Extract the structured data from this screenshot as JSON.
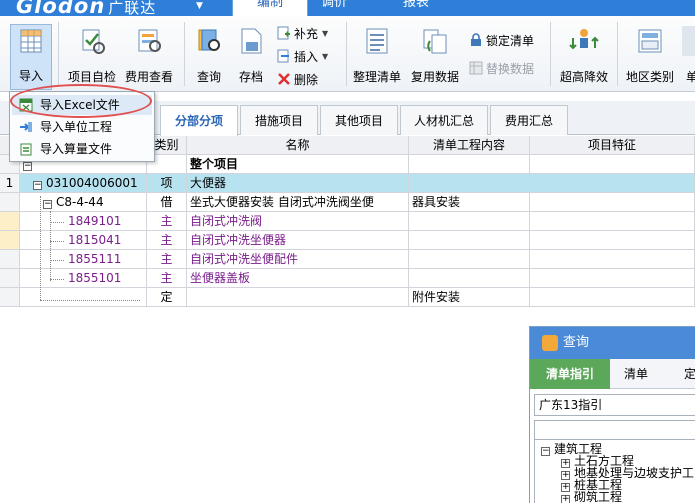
{
  "app": {
    "logo_text": "Glodon",
    "logo_cn": "广联达",
    "main_tabs": [
      "编制",
      "调价",
      "报表"
    ]
  },
  "ribbon": {
    "import": "导入",
    "self_check": "项目自检",
    "fee_view": "费用查看",
    "query": "查询",
    "save": "存档",
    "supplement": "补充",
    "insert": "插入",
    "delete": "删除",
    "organize": "整理清单",
    "reuse": "复用数据",
    "lock": "锁定清单",
    "replace": "替换数据",
    "reduce": "超高降效",
    "region": "地区类别",
    "cut_label": "单"
  },
  "import_menu": {
    "items": [
      "导入Excel文件",
      "导入单位工程",
      "导入算量文件"
    ]
  },
  "subtabs": [
    "分部分项",
    "措施项目",
    "其他项目",
    "人材机汇总",
    "费用汇总"
  ],
  "grid": {
    "headers": {
      "type": "类别",
      "name": "名称",
      "content": "清单工程内容",
      "feature": "项目特征"
    },
    "rows": [
      {
        "num": "",
        "code": "",
        "type": "",
        "name": "整个项目",
        "content": ""
      },
      {
        "num": "1",
        "code": "031004006001",
        "type": "项",
        "name": "大便器",
        "content": ""
      },
      {
        "num": "",
        "code": "C8-4-44",
        "type": "借",
        "name": "坐式大便器安装 自闭式冲洗阀坐便",
        "content": "器具安装"
      },
      {
        "num": "",
        "code": "1849101",
        "type": "主",
        "name": "自闭式冲洗阀",
        "content": ""
      },
      {
        "num": "",
        "code": "1815041",
        "type": "主",
        "name": "自闭式冲洗坐便器",
        "content": ""
      },
      {
        "num": "",
        "code": "1855111",
        "type": "主",
        "name": "自闭式冲洗坐便配件",
        "content": ""
      },
      {
        "num": "",
        "code": "1855101",
        "type": "主",
        "name": "坐便器盖板",
        "content": ""
      },
      {
        "num": "",
        "code": "",
        "type": "定",
        "name": "",
        "content": "附件安装"
      }
    ]
  },
  "query_panel": {
    "title": "查询",
    "tabs": [
      "清单指引",
      "清单",
      "定"
    ],
    "selected_value": "广东13指引",
    "tree": {
      "root": "建筑工程",
      "children": [
        "土石方工程",
        "地基处理与边坡支护工",
        "桩基工程",
        "砌筑工程"
      ]
    }
  },
  "colors": {
    "title_bar": "#2f7fd8",
    "selected_row": "#b7e3f1",
    "accent_text": "#7a1e8a",
    "guide_tab": "#5ca85a",
    "callout_circle": "#e05050"
  }
}
